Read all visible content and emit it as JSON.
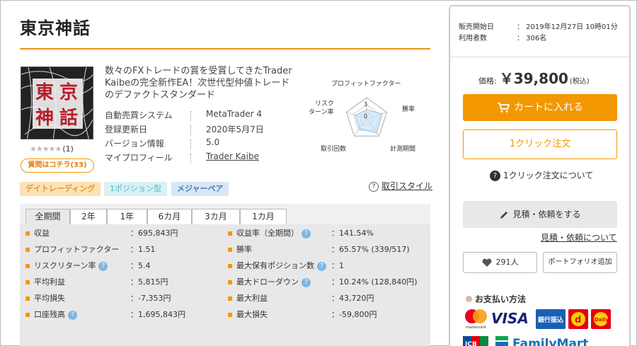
{
  "product": {
    "title": "東京神話",
    "description": "数々のFXトレードの賞を受賞してきたTrader Kaibeの完全新作EA！次世代型仲値トレードのデファクトスタンダード",
    "rating_count": "(1)",
    "question_button": "質問はコチラ(33)",
    "thumbnail_calligraphy": "東京神話"
  },
  "specs": [
    {
      "label": "自動売買システム",
      "value": "MetaTrader 4"
    },
    {
      "label": "登録更新日",
      "value": "2020年5月7日"
    },
    {
      "label": "バージョン情報",
      "value": "5.0"
    },
    {
      "label": "マイプロフィール",
      "value": "Trader Kaibe"
    }
  ],
  "radar": {
    "labels": {
      "pf": "プロフィットファクター",
      "winrate": "勝率",
      "period": "計測期間",
      "trades": "取引回数",
      "riskreturn_l1": "リスク",
      "riskreturn_l2": "ターン率"
    },
    "scale_max": "3",
    "scale_min": "0"
  },
  "tags": [
    {
      "label": "デイトレーディング",
      "bg": "#fbe2b6",
      "fg": "#e8961e"
    },
    {
      "label": "1ポジション型",
      "bg": "#d9f1f4",
      "fg": "#56b9c9"
    },
    {
      "label": "メジャーペア",
      "bg": "#d8e6f6",
      "fg": "#4a7fc1"
    }
  ],
  "trade_style_link": "取引スタイル",
  "tabs": [
    "全期間",
    "2年",
    "1年",
    "6カ月",
    "3カ月",
    "1カ月"
  ],
  "stats_left": [
    {
      "label": "収益",
      "value": "：695,843円",
      "hint": false
    },
    {
      "label": "プロフィットファクター",
      "value": "：1.51",
      "hint": false
    },
    {
      "label": "リスクリターン率",
      "value": "：5.4",
      "hint": true
    },
    {
      "label": "平均利益",
      "value": "：5,815円",
      "hint": false
    },
    {
      "label": "平均損失",
      "value": "：-7,353円",
      "hint": false
    },
    {
      "label": "口座残高",
      "value": "：1,695,843円",
      "hint": true
    }
  ],
  "stats_right": [
    {
      "label": "収益率（全期間）",
      "value": "：141.54%",
      "hint": true
    },
    {
      "label": "勝率",
      "value": "：65.57% (339/517)",
      "hint": false
    },
    {
      "label": "最大保有ポジション数",
      "value": "：1",
      "hint": true
    },
    {
      "label": "最大ドローダウン",
      "value": "：10.24% (128,840円)",
      "hint": true
    },
    {
      "label": "最大利益",
      "value": "：43,720円",
      "hint": false
    },
    {
      "label": "最大損失",
      "value": "：-59,800円",
      "hint": false
    }
  ],
  "sidebar": {
    "sale_start_label": "販売開始日",
    "sale_start_value": "： 2019年12月27日 10時01分",
    "users_label": "利用者数",
    "users_value": "： 306名",
    "price_label": "価格:",
    "price_value": "￥39,800",
    "price_tax": "(税込)",
    "cart_button": "カートに入れる",
    "oneclick_button": "1クリック注文",
    "oneclick_info": "1クリック注文について",
    "estimate_button": "見積・依頼をする",
    "estimate_link": "見積・依頼について",
    "favorite_count": "291人",
    "portfolio_button": "ポートフォリオ追加",
    "payment_title": "お支払い方法",
    "payment_logos": {
      "mastercard": "mastercard",
      "visa": "VISA",
      "bank": "銀行振込",
      "dpay": "d",
      "daily": "Daily",
      "jcb": "JCB",
      "familymart": "FamilyMart"
    }
  },
  "colors": {
    "accent": "#f39800",
    "title_rule": "#e8961e",
    "hint": "#7fb6e0"
  }
}
